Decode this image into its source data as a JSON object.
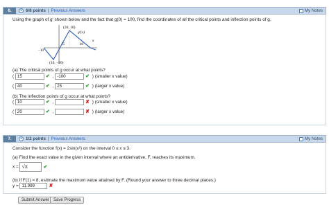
{
  "q6": {
    "number": "6.",
    "points": "6/8 points",
    "sep": "|",
    "previous": "Previous Answers",
    "notes": "My Notes",
    "prompt": "Using the graph of g' shown below and the fact that g(0) = 100, find the coordinates of all the critical points and inflection points of g.",
    "graph": {
      "curve_label": "g'(x)",
      "peak": "(20, 10)",
      "trough": "(10, −20)",
      "x_15": "15",
      "x_40": "40",
      "x_axis": "x",
      "neg10": "−10"
    },
    "part_a": {
      "question": "(a) The critical points of g occur at what points?",
      "row1": {
        "open": "(",
        "x": "15",
        "comma": ",",
        "y": "-100",
        "close": ")",
        "label": "(smaller x value)"
      },
      "row2": {
        "open": "(",
        "x": "40",
        "comma": ",",
        "y": "25",
        "close": ")",
        "label": "(larger x value)"
      }
    },
    "part_b": {
      "question": "(b) The inflection points of g occur at what points?",
      "row1": {
        "open": "(",
        "x": "10",
        "comma": ",",
        "y": "",
        "close": ")",
        "label": "(smaller x value)"
      },
      "row2": {
        "open": "(",
        "x": "20",
        "comma": ",",
        "y": "",
        "close": ")",
        "label": "(larger x value)"
      }
    }
  },
  "q7": {
    "number": "7.",
    "points": "1/2 points",
    "sep": "|",
    "previous": "Previous Answers",
    "notes": "My Notes",
    "prompt": "Consider the function f(x) = 2sin(x²) on the interval 0 ≤ x ≤ 3.",
    "part_a": {
      "question": "(a) Find the exact value in the given interval where an antiderivative, F, reaches its maximum.",
      "var": "x =",
      "answer": "√π"
    },
    "part_b": {
      "question": "(b) If F(1) = 8, estimate the maximum value attained by F. (Round your answer to three decimal places.)",
      "var": "y =",
      "answer": "11.999"
    }
  },
  "buttons": {
    "submit": "Submit Answer",
    "save": "Save Progress"
  }
}
